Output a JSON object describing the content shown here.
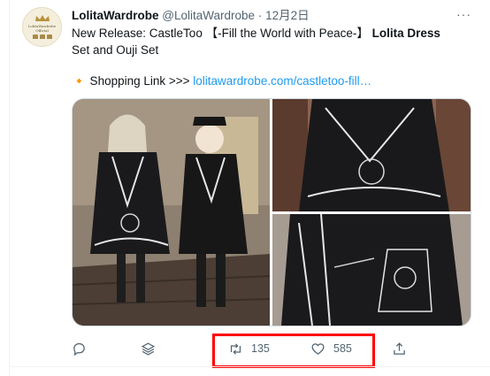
{
  "tweet": {
    "author_name": "LolitaWardrobe",
    "handle": "@LolitaWardrobe",
    "separator": "·",
    "date": "12月2日",
    "more_label": "···",
    "text_part1": "New Release: CastleToo 【-Fill the World with Peace-】 ",
    "text_bold": "Lolita Dress",
    "text_part2": " Set and Ouji Set",
    "shopping_prefix": "🔸 Shopping Link >>> ",
    "shopping_link": "lolitawardrobe.com/castletoo-fill…"
  },
  "avatar": {
    "brand_text": "LolitaWardrobe Official"
  },
  "actions": {
    "reply_icon": "reply-icon",
    "layers_icon": "layers-icon",
    "retweet_count": "135",
    "like_count": "585",
    "share_icon": "share-icon"
  },
  "media": {
    "images": [
      "photo-two-models",
      "photo-dress-front",
      "photo-dress-detail"
    ]
  },
  "colors": {
    "link": "#1d9bf0",
    "muted": "#536471",
    "highlight": "#ff0000"
  }
}
